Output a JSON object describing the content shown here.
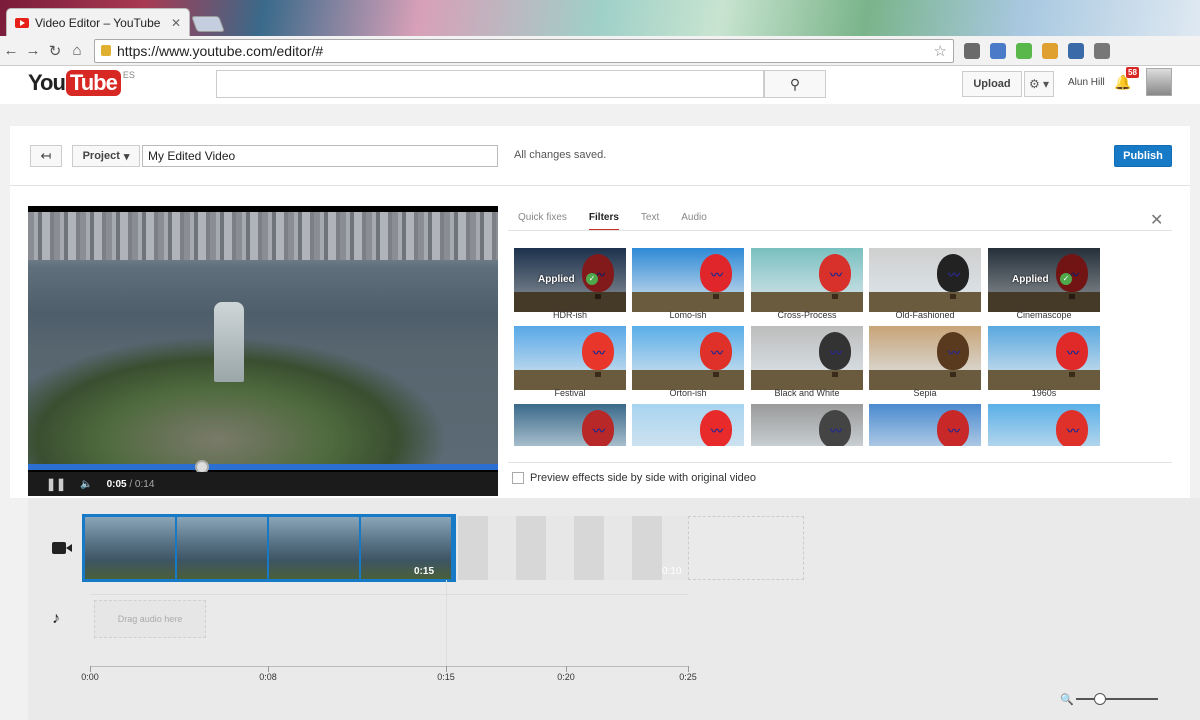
{
  "browser": {
    "tab_title": "Video Editor – YouTube",
    "url": "https://www.youtube.com/editor/#"
  },
  "youtube": {
    "logo_you": "You",
    "logo_tube": "Tube",
    "logo_region": "ES",
    "upload_label": "Upload",
    "username": "Alun Hill",
    "notification_count": "58"
  },
  "project": {
    "project_label": "Project",
    "name": "My Edited Video",
    "save_status": "All changes saved.",
    "publish_label": "Publish"
  },
  "player": {
    "current_time": "0:05",
    "duration": "/ 0:14",
    "progress_fraction": 0.37
  },
  "effects": {
    "tabs": [
      "Quick fixes",
      "Filters",
      "Text",
      "Audio"
    ],
    "active_tab": "Filters",
    "applied_label": "Applied",
    "preview_label": "Preview effects side by side with original video",
    "filters": [
      {
        "name": "HDR-ish",
        "applied": true,
        "sky": "#2b4d78",
        "balloon": "#c8282a"
      },
      {
        "name": "Lomo-ish",
        "applied": false,
        "sky": "#2e8ad6",
        "balloon": "#e0262a"
      },
      {
        "name": "Cross-Process",
        "applied": false,
        "sky": "#7ac0c0",
        "balloon": "#d8302a"
      },
      {
        "name": "Old-Fashioned",
        "applied": false,
        "sky": "#cfcfcf",
        "balloon": "#222222"
      },
      {
        "name": "Cinemascope",
        "applied": true,
        "sky": "#3a4a5a",
        "balloon": "#b02020"
      },
      {
        "name": "Festival",
        "applied": false,
        "sky": "#58a8e8",
        "balloon": "#e8362a"
      },
      {
        "name": "Orton-ish",
        "applied": false,
        "sky": "#5aaee8",
        "balloon": "#e0302a"
      },
      {
        "name": "Black and White",
        "applied": false,
        "sky": "#bdbdbd",
        "balloon": "#333333"
      },
      {
        "name": "Sepia",
        "applied": false,
        "sky": "#c8a478",
        "balloon": "#5a3a1e"
      },
      {
        "name": "1960s",
        "applied": false,
        "sky": "#5aa8e0",
        "balloon": "#e02a2a"
      },
      {
        "name": "",
        "applied": false,
        "sky": "#3a6a8a",
        "balloon": "#b82828"
      },
      {
        "name": "",
        "applied": false,
        "sky": "#a8d4f0",
        "balloon": "#e82a2a"
      },
      {
        "name": "",
        "applied": false,
        "sky": "#9a9a9a",
        "balloon": "#444444"
      },
      {
        "name": "",
        "applied": false,
        "sky": "#4a8ad0",
        "balloon": "#c82828"
      },
      {
        "name": "",
        "applied": false,
        "sky": "#5ab0e8",
        "balloon": "#e0302a"
      }
    ]
  },
  "timeline": {
    "clip_duration": "0:15",
    "ghost_duration": "0:10",
    "drag_audio_label": "Drag audio here",
    "ruler": [
      "0:00",
      "0:08",
      "0:15",
      "0:20",
      "0:25"
    ]
  },
  "colors": {
    "accent": "#167ac6",
    "brand_red": "#d82824"
  }
}
